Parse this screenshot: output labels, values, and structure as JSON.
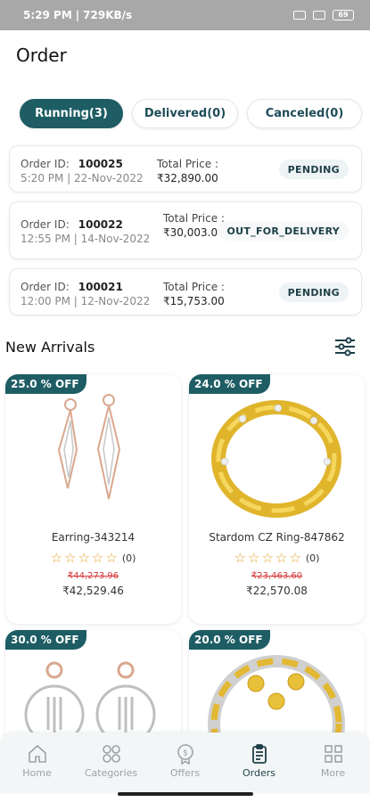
{
  "status_bar": {
    "time": "5:29 PM",
    "speed": "729KB/s",
    "battery": "69"
  },
  "page": {
    "title": "Order"
  },
  "tabs": [
    {
      "label": "Running(3)",
      "active": true
    },
    {
      "label": "Delivered(0)",
      "active": false
    },
    {
      "label": "Canceled(0)",
      "active": false
    }
  ],
  "orders": [
    {
      "id_label": "Order ID:",
      "id": "100025",
      "datetime": "5:20 PM | 22-Nov-2022",
      "price_label": "Total Price :",
      "price": "₹32,890.00",
      "status": "PENDING"
    },
    {
      "id_label": "Order ID:",
      "id": "100022",
      "datetime": "12:55 PM | 14-Nov-2022",
      "price_label": "Total Price :",
      "price": "₹30,003.00",
      "status": "OUT_FOR_DELIVERY"
    },
    {
      "id_label": "Order ID:",
      "id": "100021",
      "datetime": "12:00 PM | 12-Nov-2022",
      "price_label": "Total Price :",
      "price": "₹15,753.00",
      "status": "PENDING"
    }
  ],
  "new_arrivals": {
    "title": "New Arrivals",
    "products": [
      {
        "discount": "25.0 % OFF",
        "name": "Earring-343214",
        "rating_count": "(0)",
        "old_price": "₹44,273.96",
        "new_price": "₹42,529.46",
        "image": "rose-gold-drop-earring"
      },
      {
        "discount": "24.0 % OFF",
        "name": "Stardom CZ Ring-847862",
        "rating_count": "(0)",
        "old_price": "₹23,463.60",
        "new_price": "₹22,570.08",
        "image": "gold-chain-ring"
      },
      {
        "discount": "30.0 % OFF",
        "name": "",
        "rating_count": "",
        "old_price": "",
        "new_price": "",
        "image": "hoop-earring"
      },
      {
        "discount": "20.0 % OFF",
        "name": "",
        "rating_count": "",
        "old_price": "",
        "new_price": "",
        "image": "gold-floral-band"
      }
    ]
  },
  "bottom_nav": [
    {
      "label": "Home",
      "icon": "home-icon",
      "active": false
    },
    {
      "label": "Categories",
      "icon": "categories-icon",
      "active": false
    },
    {
      "label": "Offers",
      "icon": "offers-icon",
      "active": false
    },
    {
      "label": "Orders",
      "icon": "orders-icon",
      "active": true
    },
    {
      "label": "More",
      "icon": "more-icon",
      "active": false
    }
  ],
  "colors": {
    "primary": "#1e5d64",
    "status_bg": "#eef3f5",
    "star": "#e3a32a",
    "strike_price": "#d83a3a"
  }
}
